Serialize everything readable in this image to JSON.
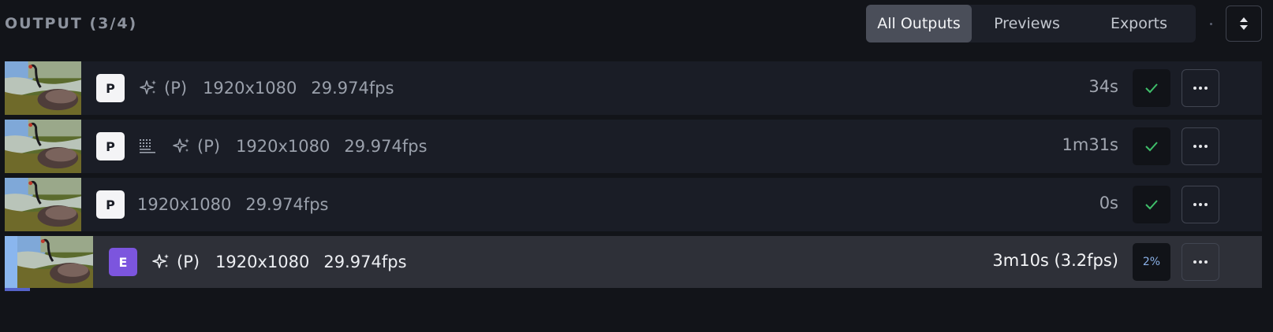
{
  "header": {
    "title": "OUTPUT (3/4)",
    "tabs": [
      {
        "label": "All Outputs",
        "active": true
      },
      {
        "label": "Previews",
        "active": false
      },
      {
        "label": "Exports",
        "active": false
      }
    ]
  },
  "icons": {
    "sort": "sort-updown-icon",
    "enhance": "sparkles-icon",
    "subtitles": "grid-lines-icon",
    "done": "check-icon",
    "more": "more-horizontal-icon"
  },
  "colors": {
    "background": "#121419",
    "row": "#1a1d26",
    "row_active": "#2e3038",
    "check": "#3fbf6a",
    "badge_e": "#7c55de",
    "progress": "#5563c9"
  },
  "rows": [
    {
      "badge": "P",
      "enhance_label": "(P)",
      "resolution": "1920x1080",
      "fps": "29.974fps",
      "duration": "34s",
      "status": "done"
    },
    {
      "badge": "P",
      "enhance_label": "(P)",
      "resolution": "1920x1080",
      "fps": "29.974fps",
      "duration": "1m31s",
      "status": "done"
    },
    {
      "badge": "P",
      "resolution": "1920x1080",
      "fps": "29.974fps",
      "duration": "0s",
      "status": "done"
    },
    {
      "badge": "E",
      "enhance_label": "(P)",
      "resolution": "1920x1080",
      "fps": "29.974fps",
      "duration": "3m10s (3.2fps)",
      "progress_text": "2%",
      "progress": 0.02,
      "status": "processing"
    }
  ]
}
